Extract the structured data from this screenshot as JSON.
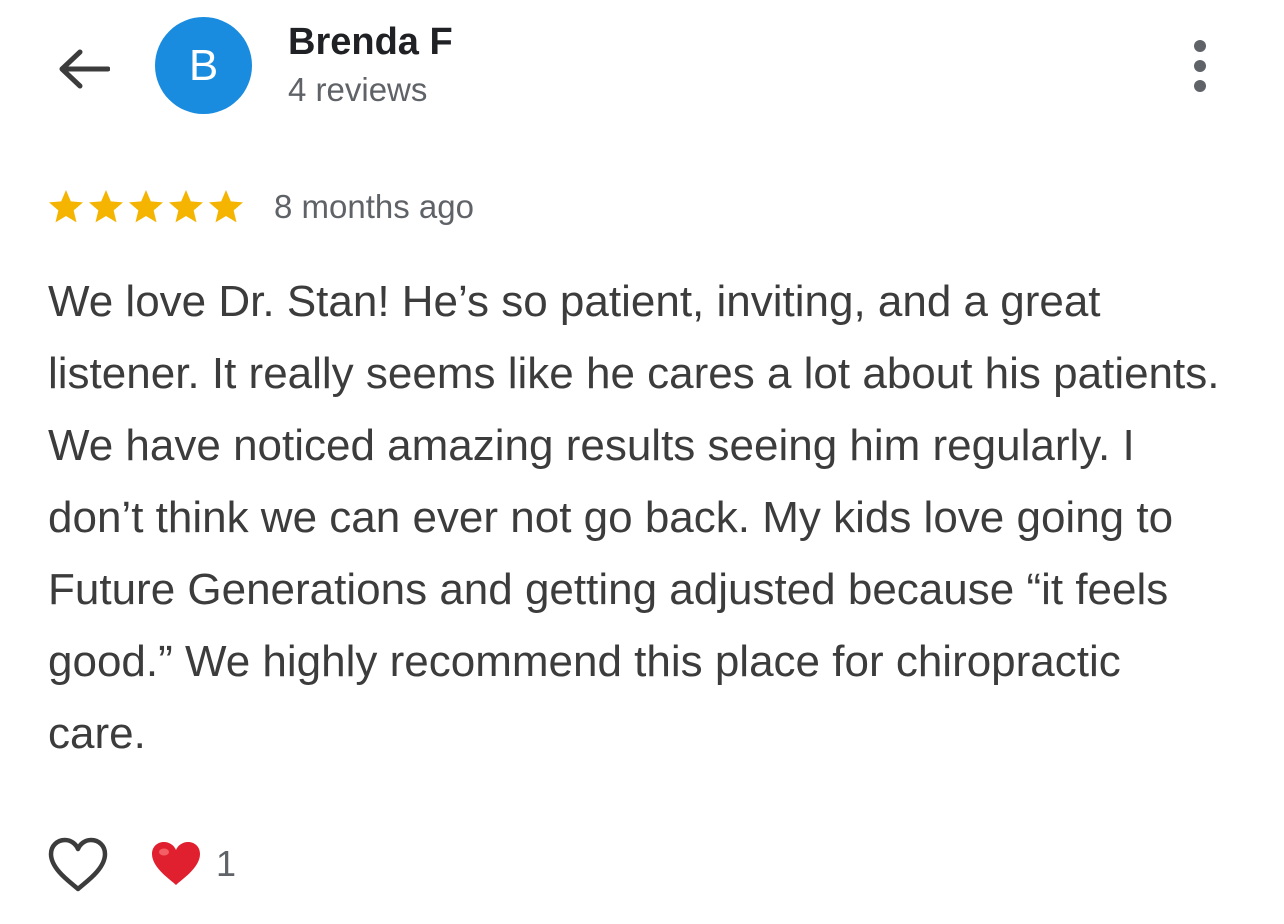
{
  "header": {
    "back_icon": "arrow-back-icon",
    "avatar_letter": "B",
    "avatar_color": "#1a8ce0",
    "name": "Brenda F",
    "review_count": "4 reviews",
    "menu_icon": "more-vert-icon"
  },
  "review": {
    "rating": 5,
    "rating_max": 5,
    "star_color": "#f5b400",
    "time": "8 months ago",
    "text": "We love Dr. Stan! He’s so patient, inviting, and a great listener. It really seems like he cares a lot about his patients. We have noticed amazing results seeing him regularly. I don’t think we can ever not go back. My kids love going to Future Generations and getting adjusted because “it feels good.” We highly recommend this place for chiropractic care."
  },
  "footer": {
    "like_icon": "heart-outline-icon",
    "reaction_icon": "red-heart-icon",
    "reaction_color": "#e0202e",
    "reaction_count": "1"
  }
}
